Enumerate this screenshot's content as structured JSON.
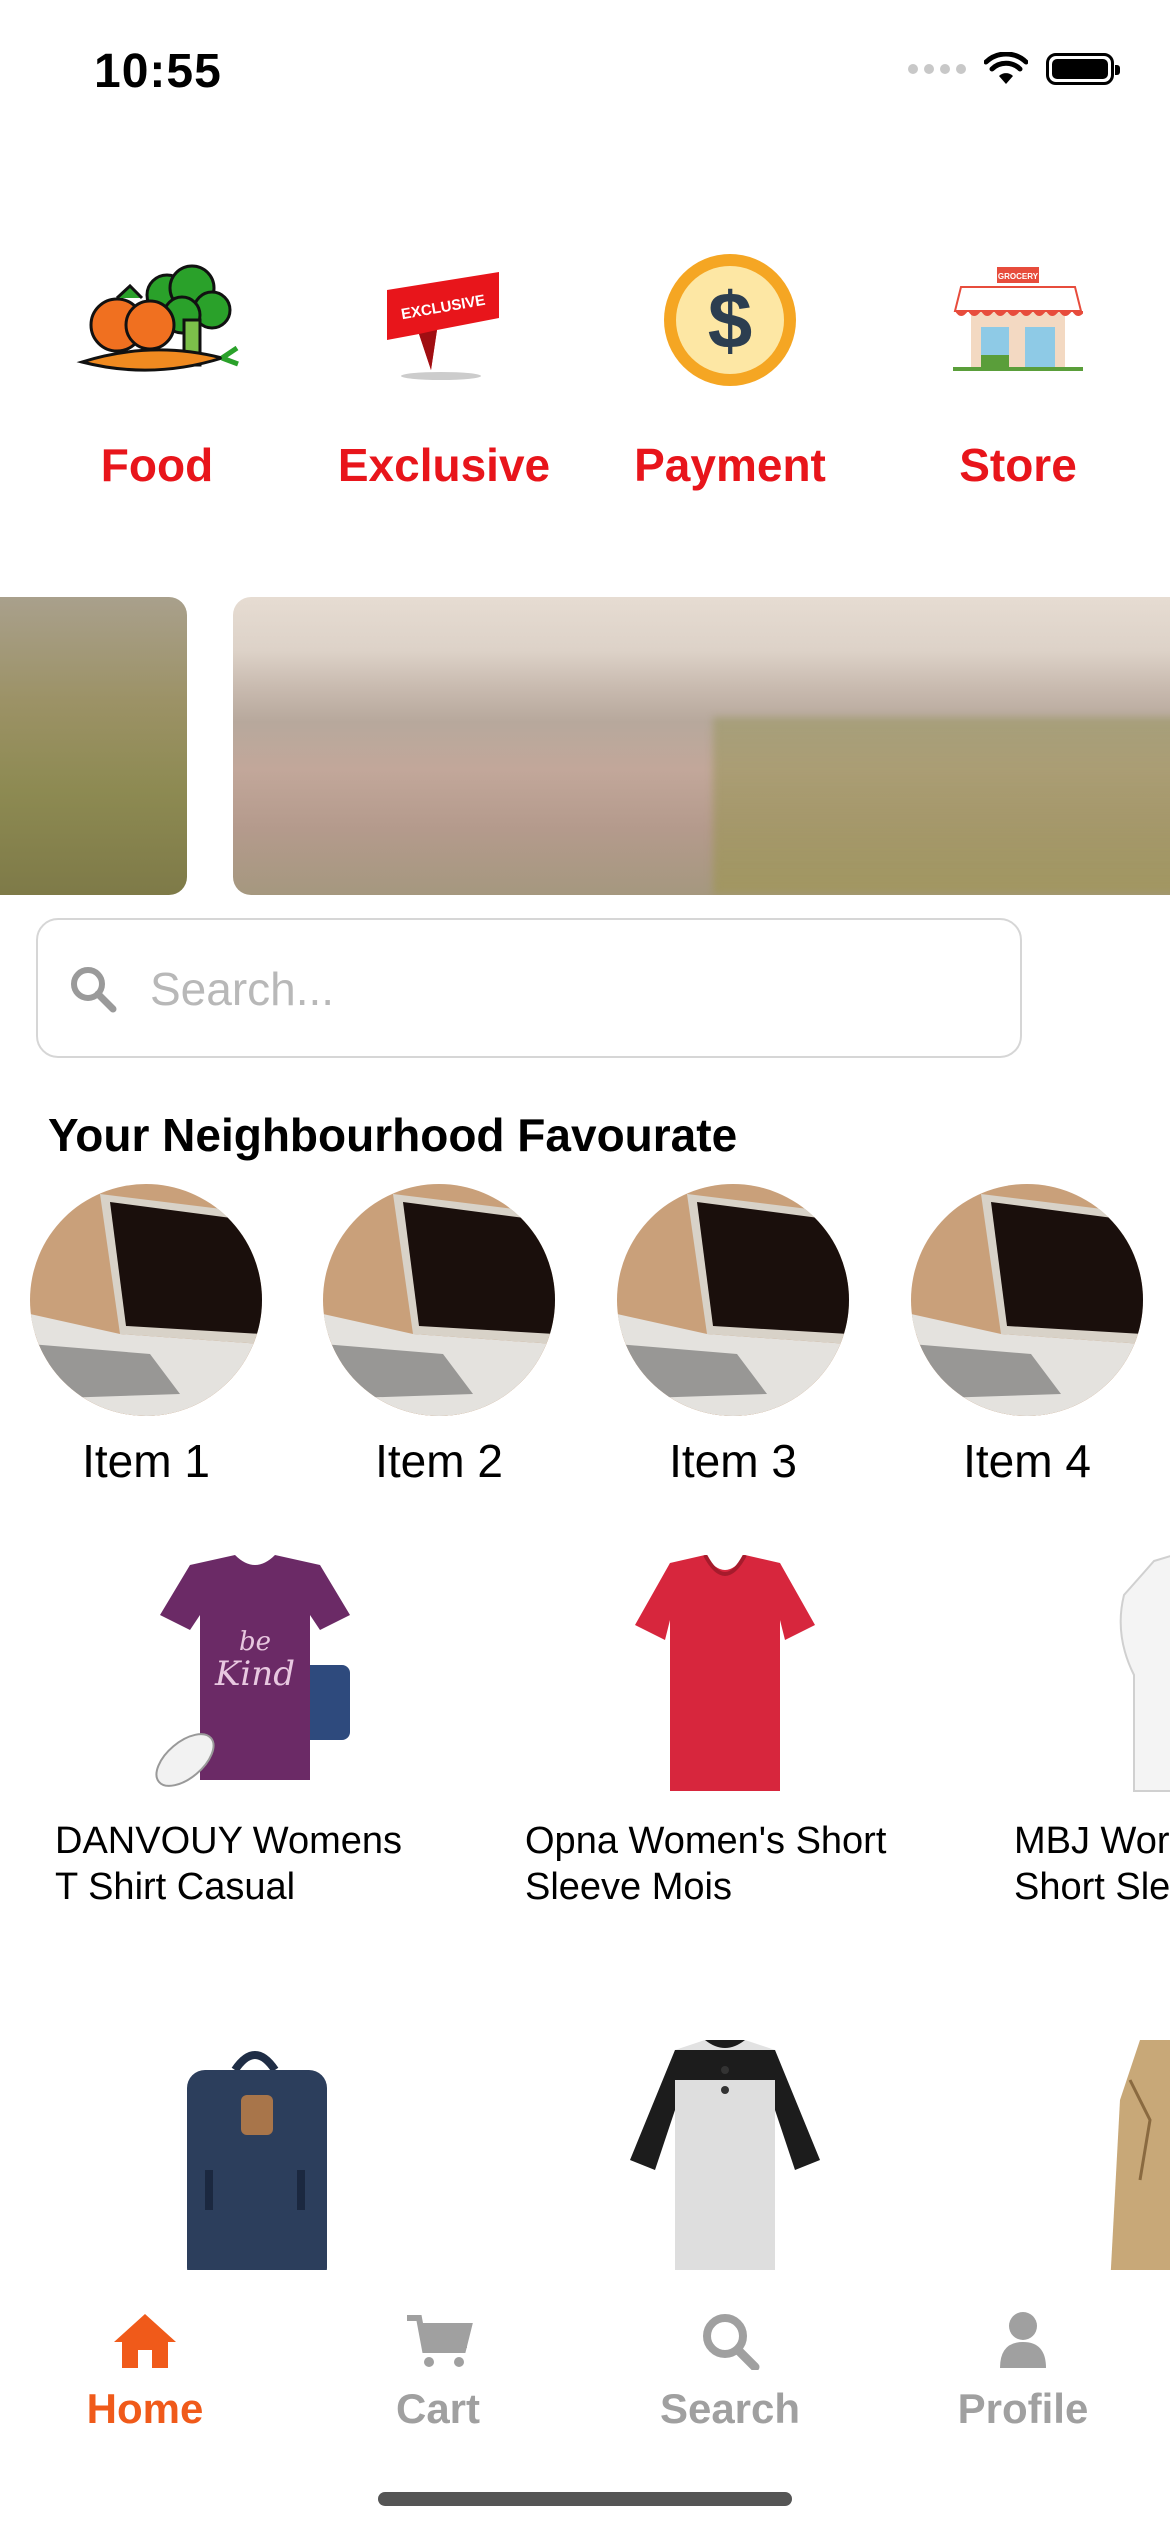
{
  "status_bar": {
    "time": "10:55"
  },
  "categories": [
    {
      "label": "Food",
      "icon": "vegetables-icon"
    },
    {
      "label": "Exclusive",
      "icon": "exclusive-ribbon-icon"
    },
    {
      "label": "Payment",
      "icon": "dollar-coin-icon"
    },
    {
      "label": "Store",
      "icon": "grocery-store-icon"
    }
  ],
  "search": {
    "placeholder": "Search..."
  },
  "favourites": {
    "title": "Your Neighbourhood Favourate",
    "items": [
      {
        "label": "Item 1"
      },
      {
        "label": "Item 2"
      },
      {
        "label": "Item 3"
      },
      {
        "label": "Item 4"
      }
    ]
  },
  "products": [
    {
      "title": "DANVOUY Womens\nT Shirt Casual"
    },
    {
      "title": "Opna Women's Short\nSleeve Mois"
    },
    {
      "title": "MBJ Wor\nShort Sle"
    }
  ],
  "tabs": [
    {
      "label": "Home",
      "icon": "home-icon",
      "active": true
    },
    {
      "label": "Cart",
      "icon": "cart-icon"
    },
    {
      "label": "Search",
      "icon": "search-icon"
    },
    {
      "label": "Profile",
      "icon": "profile-icon"
    }
  ],
  "colors": {
    "category_text": "#e8151b",
    "tab_active": "#f05a1a",
    "tab_inactive": "#a0a0a0"
  }
}
